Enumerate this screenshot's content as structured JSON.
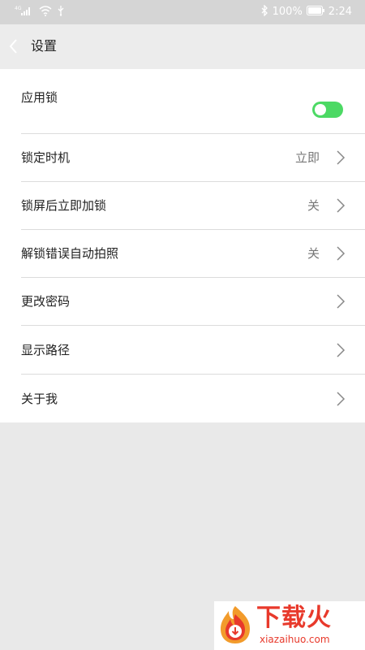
{
  "status_bar": {
    "battery": "100%",
    "time": "2:24",
    "signal_label": "4G"
  },
  "app_bar": {
    "title": "设置"
  },
  "settings": {
    "app_lock_label": "应用锁",
    "app_lock_enabled": true,
    "rows": [
      {
        "label": "锁定时机",
        "value": "立即"
      },
      {
        "label": "锁屏后立即加锁",
        "value": "关"
      },
      {
        "label": "解锁错误自动拍照",
        "value": "关"
      },
      {
        "label": "更改密码",
        "value": ""
      },
      {
        "label": "显示路径",
        "value": ""
      },
      {
        "label": "关于我",
        "value": ""
      }
    ]
  },
  "watermark": {
    "brand": "下载火",
    "url": "xiazaihuo.com"
  },
  "colors": {
    "toggle_on": "#4cd964",
    "brand_red": "#e8392b"
  }
}
